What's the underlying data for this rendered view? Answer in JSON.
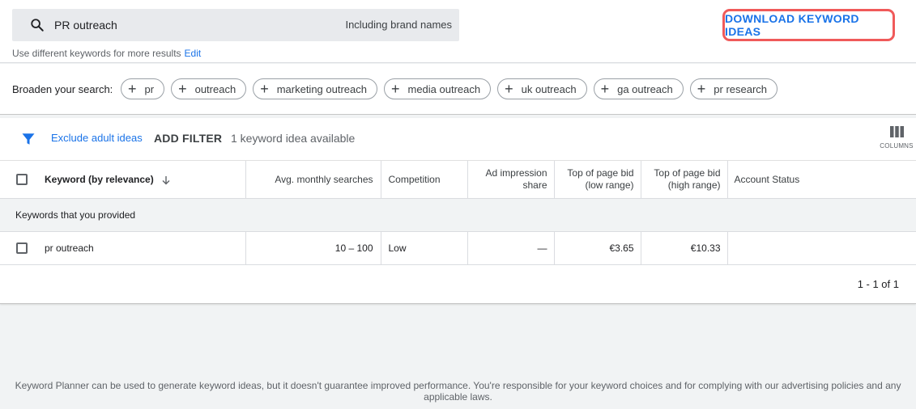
{
  "search": {
    "query": "PR outreach",
    "brand_option": "Including brand names",
    "hint": "Use different keywords for more results",
    "edit_label": "Edit"
  },
  "download_label": "DOWNLOAD KEYWORD IDEAS",
  "broaden": {
    "label": "Broaden your search:",
    "chips": [
      {
        "label": "pr"
      },
      {
        "label": "outreach"
      },
      {
        "label": "marketing outreach"
      },
      {
        "label": "media outreach"
      },
      {
        "label": "uk outreach"
      },
      {
        "label": "ga outreach"
      },
      {
        "label": "pr research"
      }
    ]
  },
  "toolbar": {
    "exclude_label": "Exclude adult ideas",
    "add_filter_label": "ADD FILTER",
    "available_text": "1 keyword idea available",
    "columns_label": "COLUMNS"
  },
  "table": {
    "headers": {
      "keyword": "Keyword (by relevance)",
      "searches": "Avg. monthly searches",
      "competition": "Competition",
      "impression_1": "Ad impression",
      "impression_2": "share",
      "low_bid_1": "Top of page bid",
      "low_bid_2": "(low range)",
      "high_bid_1": "Top of page bid",
      "high_bid_2": "(high range)",
      "account_status": "Account Status"
    },
    "group_label": "Keywords that you provided",
    "rows": [
      {
        "keyword": "pr outreach",
        "searches": "10 – 100",
        "competition": "Low",
        "impression_share": "—",
        "low_bid": "€3.65",
        "high_bid": "€10.33",
        "account_status": ""
      }
    ],
    "pagination": "1 - 1 of 1"
  },
  "footer": "Keyword Planner can be used to generate keyword ideas, but it doesn't guarantee improved performance. You're responsible for your keyword choices and for complying with our advertising policies and any applicable laws.",
  "colors": {
    "accent": "#1a73e8",
    "highlight_border": "#f05a5a"
  },
  "icons": [
    "search-icon",
    "plus-icon",
    "filter-icon",
    "columns-icon",
    "arrow-down-icon"
  ]
}
